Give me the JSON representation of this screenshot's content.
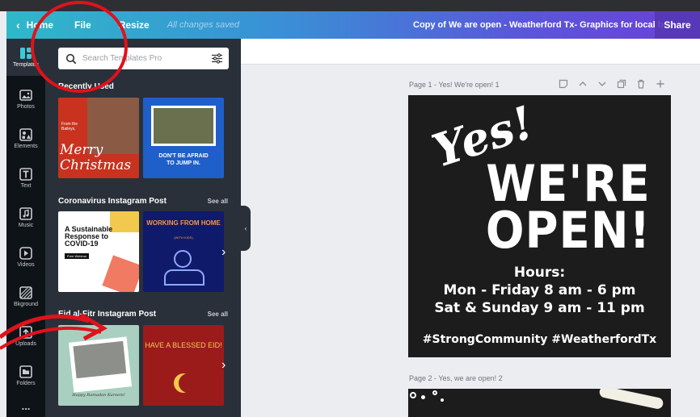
{
  "header": {
    "home_label": "Home",
    "file_label": "File",
    "resize_label": "Resize",
    "saved_status": "All changes saved",
    "doc_title": "Copy of We are open - Weatherford Tx- Graphics for local bu...",
    "share_label": "Share",
    "gradient_colors": [
      "#2fb8c9",
      "#3a8fd6",
      "#5a56d9",
      "#6c3fd8"
    ]
  },
  "rail": {
    "items": [
      {
        "label": "Templates",
        "icon": "templates-icon"
      },
      {
        "label": "Photos",
        "icon": "photos-icon"
      },
      {
        "label": "Elements",
        "icon": "elements-icon"
      },
      {
        "label": "Text",
        "icon": "text-icon"
      },
      {
        "label": "Music",
        "icon": "music-icon"
      },
      {
        "label": "Videos",
        "icon": "videos-icon"
      },
      {
        "label": "Bkground",
        "icon": "background-icon"
      },
      {
        "label": "Uploads",
        "icon": "uploads-icon"
      },
      {
        "label": "Folders",
        "icon": "folders-icon"
      }
    ],
    "more_label": "..."
  },
  "panel": {
    "search_placeholder": "Search Templates Pro",
    "sections": [
      {
        "title": "Recently Used",
        "see_all": ""
      },
      {
        "title": "Coronavirus Instagram Post",
        "see_all": "See all"
      },
      {
        "title": "Eid al-Fitr Instagram Post",
        "see_all": "See all"
      }
    ],
    "thumbs": {
      "xmas_small": "From the Baileys,",
      "xmas_big": "Merry Christmas",
      "jump": "DON'T BE AFRAID TO JUMP IN.",
      "covid_head": "A Sustainable Response to COVID-19",
      "covid_small": "Free Webinar",
      "wfh_title": "WORKING FROM HOME",
      "wfh_sub": "(WITH KIDS)",
      "eid_photo_caption": "Happy Ramadan Kareem!",
      "eid_title": "HAVE A BLESSED EID!"
    }
  },
  "canvas": {
    "page1_label": "Page 1 - Yes! We're open! 1",
    "page2_label": "Page 2 - Yes, we are open! 2",
    "poster": {
      "yes": "Yes!",
      "were": "WE'RE",
      "open": "OPEN!",
      "hours_title": "Hours:",
      "hours_line1": "Mon - Friday 8 am - 6 pm",
      "hours_line2": "Sat & Sunday 9 am - 11 pm",
      "hashtags": "#StrongCommunity #WeatherfordTx"
    }
  },
  "colors": {
    "accent_red": "#e0121b",
    "panel_bg": "#293039",
    "rail_bg": "#0e1318",
    "poster_bg": "#1c1c1c"
  }
}
